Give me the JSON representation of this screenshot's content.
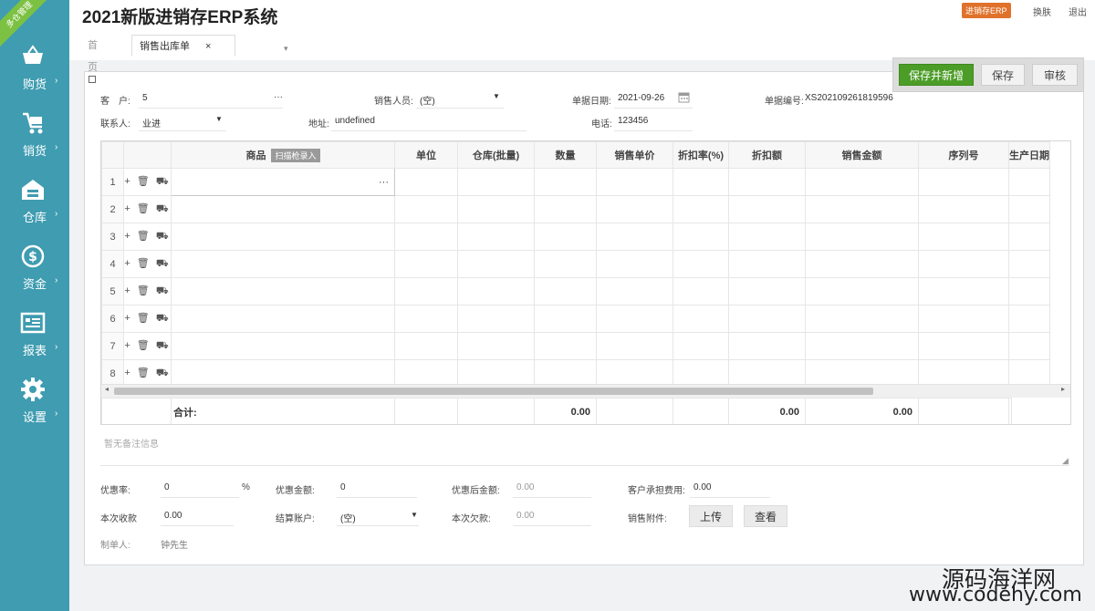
{
  "brand": {
    "ribbon": "多仓管理"
  },
  "sidebar": {
    "items": [
      {
        "label": "购货"
      },
      {
        "label": "销货"
      },
      {
        "label": "仓库"
      },
      {
        "label": "资金"
      },
      {
        "label": "报表"
      },
      {
        "label": "设置"
      }
    ]
  },
  "header": {
    "title": "2021新版进销存ERP系统",
    "badge": "进销存ERP",
    "links": {
      "skin": "换肤",
      "logout": "退出"
    }
  },
  "tabs": {
    "home": "首页",
    "active": "销售出库单",
    "close": "×",
    "menu": "▾"
  },
  "toolbar": {
    "save_new": "保存并新增",
    "save": "保存",
    "audit": "审核"
  },
  "form": {
    "customer_label": "客　户:",
    "customer_value": "5",
    "customer_more": "···",
    "salesperson_label": "销售人员:",
    "salesperson_value": "(空)",
    "date_label": "单据日期:",
    "date_value": "2021-09-26",
    "docno_label": "单据编号:",
    "docno_value": "XS202109261819596",
    "contact_label": "联系人:",
    "contact_value": "业进",
    "address_label": "地址:",
    "address_value": "undefined",
    "phone_label": "电话:",
    "phone_value": "123456"
  },
  "grid": {
    "columns": [
      "商品",
      "单位",
      "仓库(批量)",
      "数量",
      "销售单价",
      "折扣率(%)",
      "折扣额",
      "销售金额",
      "序列号",
      "生产日期"
    ],
    "scan_tag": "扫描枪录入",
    "rows": [
      "1",
      "2",
      "3",
      "4",
      "5",
      "6",
      "7",
      "8"
    ],
    "row_ops": "+ 🗑 ⛟",
    "first_cell_more": "···",
    "totals": {
      "label": "合计:",
      "qty": "0.00",
      "discount": "0.00",
      "amount": "0.00"
    }
  },
  "remark": {
    "placeholder": "暂无备注信息"
  },
  "footer": {
    "discount_rate_label": "优惠率:",
    "discount_rate_value": "0",
    "percent": "%",
    "discount_amount_label": "优惠金额:",
    "discount_amount_value": "0",
    "after_discount_label": "优惠后金额:",
    "after_discount_value": "0.00",
    "customer_fee_label": "客户承担费用:",
    "customer_fee_value": "0.00",
    "received_label": "本次收款",
    "received_value": "0.00",
    "account_label": "结算账户:",
    "account_value": "(空)",
    "debt_label": "本次欠款:",
    "debt_value": "0.00",
    "attachment_label": "销售附件:",
    "upload": "上传",
    "view": "查看",
    "maker_label": "制单人:",
    "maker_value": "钟先生"
  },
  "watermark": {
    "line1": "源码海洋网",
    "line2": "www.codehy.com"
  },
  "colors": {
    "sidebar": "#3f9cb1",
    "primary_button": "#4c9d28",
    "badge": "#e0712b",
    "ribbon": "#7cc142"
  }
}
